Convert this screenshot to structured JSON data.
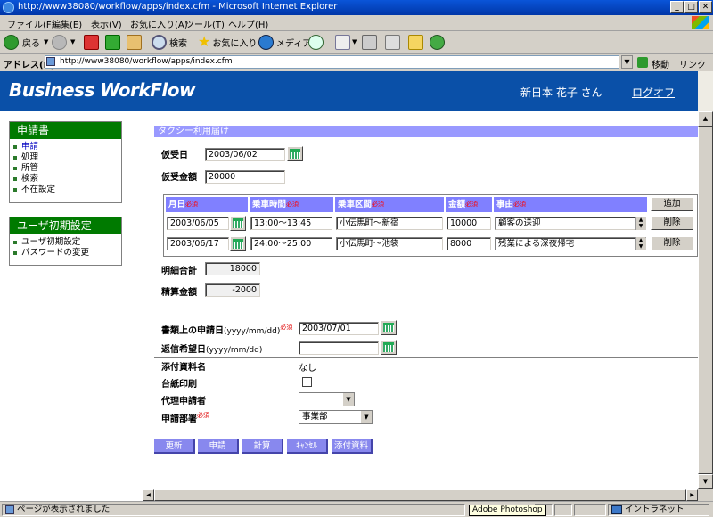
{
  "window": {
    "title": "http://www38080/workflow/apps/index.cfm - Microsoft Internet Explorer",
    "min": "_",
    "max": "□",
    "close": "✕"
  },
  "menu": [
    "ファイル(F)",
    "編集(E)",
    "表示(V)",
    "お気に入り(A)",
    "ツール(T)",
    "ヘルプ(H)"
  ],
  "toolbar": {
    "back": "戻る",
    "search": "検索",
    "favorites": "お気に入り",
    "media": "メディア"
  },
  "address": {
    "label": "アドレス(D)",
    "url": "http://www38080/workflow/apps/index.cfm",
    "go": "移動",
    "links": "リンク"
  },
  "header": {
    "logo": "Business WorkFlow",
    "user": "新日本 花子 さん",
    "logoff": "ログオフ"
  },
  "sidebar": {
    "app_title": "申請書",
    "app_items": [
      "申請",
      "処理",
      "所管",
      "検索",
      "不在設定"
    ],
    "setup_title": "ユーザ初期設定",
    "setup_items": [
      "ユーザ初期設定",
      "パスワードの変更"
    ]
  },
  "form": {
    "title": "タクシー利用届け",
    "advance_date_label": "仮受日",
    "advance_date": "2003/06/02",
    "advance_amount_label": "仮受金額",
    "advance_amount": "20000",
    "required_mark": "必須",
    "columns": [
      "月日",
      "乗車時間",
      "乗車区間",
      "金額",
      "事由"
    ],
    "add_label": "追加",
    "delete_label": "削除",
    "rows": [
      {
        "date": "2003/06/05",
        "time": "13:00～13:45",
        "route": "小伝馬町～新宿",
        "amount": "10000",
        "reason": "顧客の送迎"
      },
      {
        "date": "2003/06/17",
        "time": "24:00～25:00",
        "route": "小伝馬町～池袋",
        "amount": "8000",
        "reason": "残業による深夜帰宅"
      }
    ],
    "total_label": "明細合計",
    "total": "18000",
    "settle_label": "精算金額",
    "settle": "-2000",
    "doc_date_label": "書類上の申請日",
    "doc_date_hint": "(yyyy/mm/dd)",
    "doc_date": "2003/07/01",
    "reply_date_label": "返信希望日",
    "reply_date_hint": "(yyyy/mm/dd)",
    "reply_date": "",
    "attach_label": "添付資料名",
    "attach_value": "なし",
    "mount_label": "台紙印刷",
    "proxy_label": "代理申請者",
    "proxy_value": "",
    "dept_label": "申請部署",
    "dept_value": "事業部"
  },
  "actions": [
    "更新",
    "申請",
    "計算",
    "ｷｬﾝｾﾙ",
    "添付資料"
  ],
  "status": {
    "message": "ページが表示されました",
    "zone": "イントラネット",
    "tooltip": "Adobe Photoshop"
  }
}
